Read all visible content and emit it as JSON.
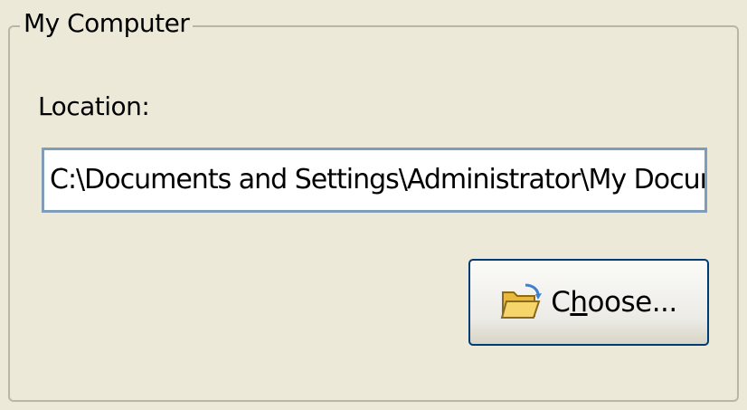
{
  "group": {
    "title": "My Computer"
  },
  "location": {
    "label": "Location:",
    "value": "C:\\Documents and Settings\\Administrator\\My Documents"
  },
  "choose_button": {
    "label_before": "C",
    "mnemonic": "h",
    "label_after": "oose...",
    "icon": "open-folder-icon"
  },
  "colors": {
    "background": "#ece9d8",
    "button_border": "#003c74",
    "input_border": "#7f9db9"
  }
}
